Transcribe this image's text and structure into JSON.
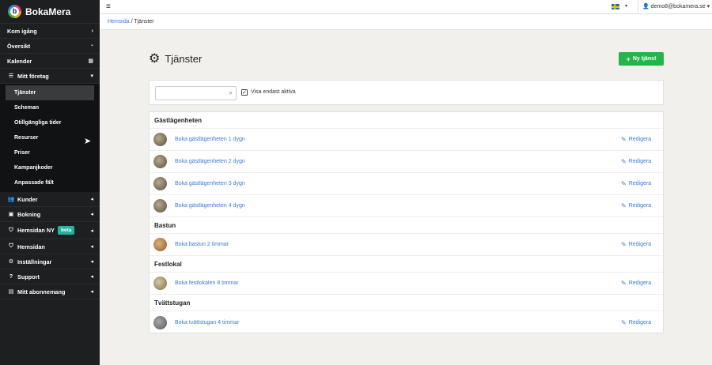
{
  "brand": {
    "name": "BokaMera",
    "logo_letter": "b"
  },
  "sidebar": {
    "items_top": [
      {
        "label": "Kom igång",
        "right": "›"
      },
      {
        "label": "Översikt",
        "right": "◔"
      },
      {
        "label": "Kalender",
        "right": "▦"
      }
    ],
    "mitt_foretag": {
      "label": "Mitt företag",
      "right": "▾"
    },
    "sub_items": [
      {
        "label": "Tjänster"
      },
      {
        "label": "Scheman"
      },
      {
        "label": "Otillgängliga tider"
      },
      {
        "label": "Resurser"
      },
      {
        "label": "Priser"
      },
      {
        "label": "Kampanjkoder"
      },
      {
        "label": "Anpassade fält"
      }
    ],
    "items_bottom": [
      {
        "label": "Kunder",
        "icon": "👥",
        "right": "◂"
      },
      {
        "label": "Bokning",
        "icon": "▣",
        "right": "◂"
      },
      {
        "label": "Hemsidan NY",
        "icon": "⛉",
        "right": "◂",
        "badge": "beta"
      },
      {
        "label": "Hemsidan",
        "icon": "⛉",
        "right": "◂"
      },
      {
        "label": "Inställningar",
        "icon": "⚙",
        "right": "◂"
      },
      {
        "label": "Support",
        "icon": "?",
        "right": "◂"
      },
      {
        "label": "Mitt abonnemang",
        "icon": "▤",
        "right": "◂"
      }
    ]
  },
  "topbar": {
    "menu_glyph": "≡",
    "user_email": "demo8@bokamera.se",
    "caret": "▾"
  },
  "breadcrumb": {
    "home": "Hemsida",
    "separator": " / ",
    "current": "Tjänster"
  },
  "page": {
    "title": "Tjänster",
    "new_button": "Ny tjänst",
    "search_placeholder": "",
    "checkbox_label": "Visa endast aktiva"
  },
  "groups": [
    {
      "name": "Gästlägenheten",
      "services": [
        {
          "name": "Boka gästlägenheten 1 dygn",
          "thumb": "apt"
        },
        {
          "name": "Boka gästlägenheten 2 dygn",
          "thumb": "apt"
        },
        {
          "name": "Boka gästlägenheten 3 dygn",
          "thumb": "apt"
        },
        {
          "name": "Boka gästlägenheten 4 dygn",
          "thumb": "apt"
        }
      ]
    },
    {
      "name": "Bastun",
      "services": [
        {
          "name": "Boka bastun 2 timmar",
          "thumb": "sauna"
        }
      ]
    },
    {
      "name": "Festlokal",
      "services": [
        {
          "name": "Boka festlokalen 8 timmar",
          "thumb": "party"
        }
      ]
    },
    {
      "name": "Tvättstugan",
      "services": [
        {
          "name": "Boka tvättstugan 4 timmar",
          "thumb": "wash"
        }
      ]
    }
  ],
  "edit_label": "Redigera",
  "colors": {
    "sidebar": "#1e1f21",
    "accent_green": "#25b34a",
    "link_blue": "#3a7bd5",
    "beta_teal": "#1fb5a0"
  }
}
